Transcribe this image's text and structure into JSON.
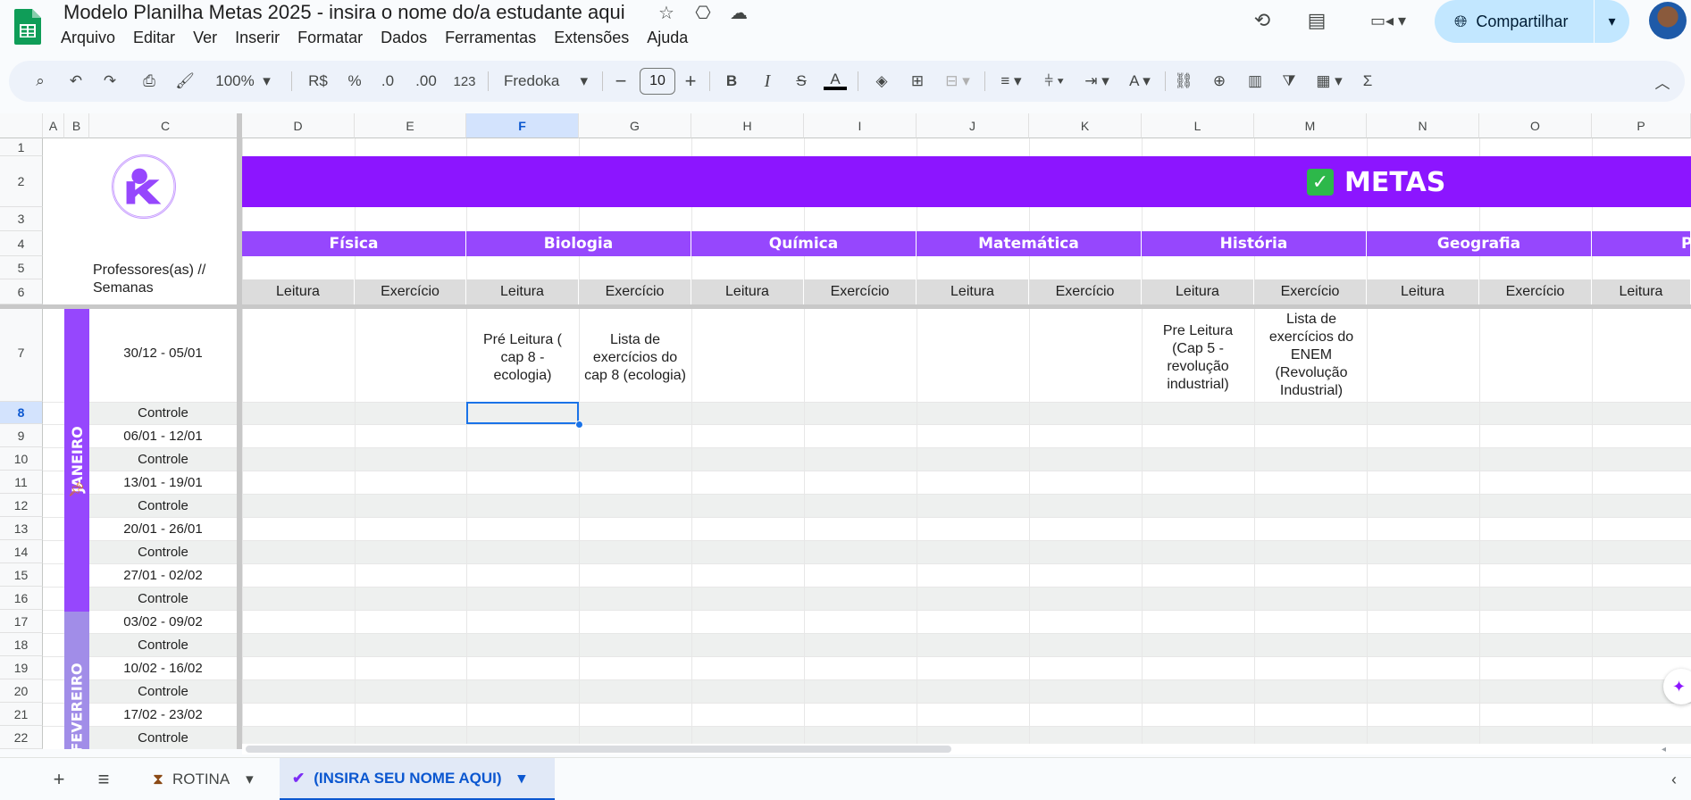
{
  "header": {
    "doc_title": "Modelo Planilha Metas 2025 - insira o nome do/a estudante aqui",
    "menu": [
      "Arquivo",
      "Editar",
      "Ver",
      "Inserir",
      "Formatar",
      "Dados",
      "Ferramentas",
      "Extensões",
      "Ajuda"
    ],
    "share_label": "Compartilhar"
  },
  "toolbar": {
    "zoom": "100%",
    "currency": "R$",
    "percent": "%",
    "dec_decrease": ".0",
    "dec_increase": ".00",
    "number_format": "123",
    "font": "Fredoka",
    "font_size": "10"
  },
  "columns": [
    "A",
    "B",
    "C",
    "D",
    "E",
    "F",
    "G",
    "H",
    "I",
    "J",
    "K",
    "L",
    "M",
    "N",
    "O",
    "P"
  ],
  "rows": [
    "1",
    "2",
    "3",
    "4",
    "5",
    "6",
    "7",
    "8",
    "9",
    "10",
    "11",
    "12",
    "13",
    "14",
    "15",
    "16",
    "17",
    "18",
    "19",
    "20",
    "21",
    "22"
  ],
  "sheet": {
    "banner_title": "METAS",
    "professors_label": "Professores(as) // Semanas",
    "subjects": [
      "Física",
      "Biologia",
      "Química",
      "Matemática",
      "História",
      "Geografia",
      "P"
    ],
    "kinds": [
      "Leitura",
      "Exercício",
      "Leitura",
      "Exercício",
      "Leitura",
      "Exercício",
      "Leitura",
      "Exercício",
      "Leitura",
      "Exercício",
      "Leitura",
      "Exercício",
      "Leitura"
    ],
    "months": [
      "JANEIRO",
      "FEVEREIRO"
    ],
    "weeks": [
      "30/12 - 05/01",
      "Controle",
      "06/01 - 12/01",
      "Controle",
      "13/01 - 19/01",
      "Controle",
      "20/01 - 26/01",
      "Controle",
      "27/01 - 02/02",
      "Controle",
      "03/02 - 09/02",
      "Controle",
      "10/02 - 16/02",
      "Controle",
      "17/02 - 23/02",
      "Controle"
    ],
    "cells": {
      "F7": "Pré Leitura ( cap 8 - ecologia)",
      "G7": "Lista de exercícios do cap 8 (ecologia)",
      "L7": "Pre Leitura (Cap 5 - revolução industrial)",
      "M7": "Lista de exercícios do ENEM (Revolução Industrial)"
    }
  },
  "sheet_tabs": [
    {
      "label": "ROTINA",
      "active": false
    },
    {
      "label": "(INSIRA SEU NOME AQUI)",
      "active": true
    }
  ],
  "colors": {
    "banner": "#8c15ff",
    "subject_bar": "#9647fd",
    "january": "#9647fd",
    "february": "#a18de8",
    "selection": "#1a73e8"
  }
}
